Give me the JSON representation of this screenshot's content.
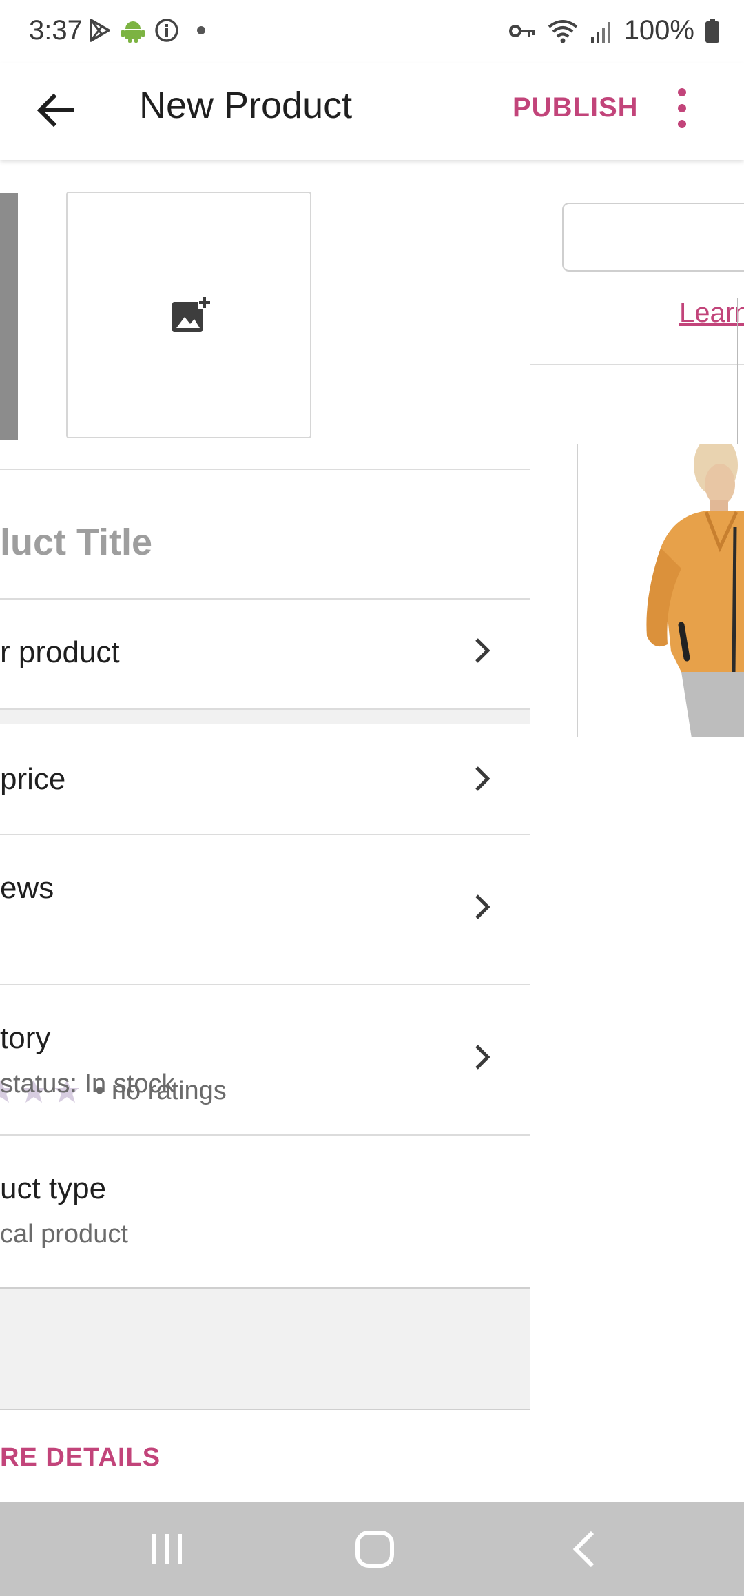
{
  "status_bar": {
    "time": "3:37",
    "battery_text": "100%",
    "icons": [
      "play-store-icon",
      "android-icon",
      "info-icon",
      "dot-icon",
      "vpn-key-icon",
      "wifi-icon",
      "signal-icon",
      "battery-icon"
    ]
  },
  "app_bar": {
    "title": "New Product",
    "publish_label": "PUBLISH"
  },
  "form": {
    "title_placeholder": "luct Title",
    "describe_label": "r product",
    "price_label": "price",
    "reviews_label": "ews",
    "reviews_sub": "• no ratings",
    "inventory_label": "tory",
    "inventory_sub": "status: In stock",
    "product_type_label": "uct type",
    "product_type_sub": "cal product",
    "more_details_label": "RE DETAILS"
  },
  "right_sheet": {
    "learn_link": "Learn"
  },
  "colors": {
    "accent": "#c2447a",
    "star": "#d7cde0",
    "navbar": "#c4c4c4"
  }
}
